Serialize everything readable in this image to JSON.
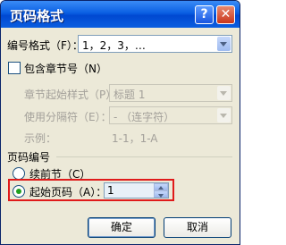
{
  "window": {
    "title": "页码格式",
    "help_label": "?",
    "close_label": "✕"
  },
  "number_format": {
    "label": "编号格式（F）：",
    "value": "1，2，3，…"
  },
  "include_chapter": {
    "label": "包含章节号（N）",
    "checked": false
  },
  "chapter_start_style": {
    "label": "章节起始样式（P）",
    "value": "标题 1"
  },
  "separator": {
    "label": "使用分隔符（E）：",
    "value": "-   （连字符）"
  },
  "example": {
    "label": "示例：",
    "value": "1-1，1-A"
  },
  "page_numbering": {
    "group_label": "页码编号",
    "continue_label": "续前节（C）",
    "start_at_label": "起始页码（A）：",
    "start_at_value": "1",
    "selected": "start_at"
  },
  "buttons": {
    "ok": "确定",
    "cancel": "取消"
  }
}
